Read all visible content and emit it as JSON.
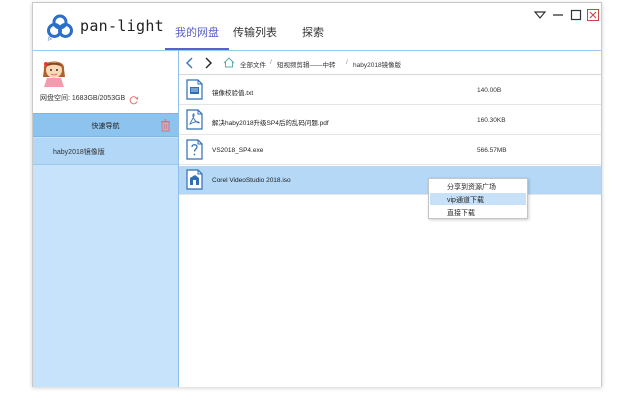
{
  "app": {
    "name": "pan-light",
    "accent_color": "#5b5fc7",
    "logo_icon": "cloud-logo"
  },
  "tabs": [
    {
      "label": "我的网盘",
      "active": true
    },
    {
      "label": "传输列表",
      "active": false
    },
    {
      "label": "探索",
      "active": false
    }
  ],
  "window_controls": {
    "dropdown": "chevron-down-icon",
    "minimize": "minimize-icon",
    "maximize": "maximize-icon",
    "close": "close-icon"
  },
  "sidebar": {
    "storage_label": "网盘空间: 1683GB/2053GB",
    "quick_nav_label": "快速导航",
    "items": [
      {
        "label": "haby2018镜像版"
      }
    ]
  },
  "pathbar": {
    "crumbs": [
      "全部文件",
      "短视频剪辑——中转",
      "haby2018镜像版"
    ]
  },
  "files": [
    {
      "name": "镜像校验值.txt",
      "size": "140.00B",
      "icon": "text-file-icon",
      "selected": false
    },
    {
      "name": "解决haby2018升级SP4后的乱码问题.pdf",
      "size": "160.30KB",
      "icon": "pdf-file-icon",
      "selected": false
    },
    {
      "name": "VS2018_SP4.exe",
      "size": "566.57MB",
      "icon": "unknown-file-icon",
      "selected": false
    },
    {
      "name": "Corel VideoStudio 2018.iso",
      "size": "",
      "icon": "disc-file-icon",
      "selected": true
    }
  ],
  "context_menu": {
    "items": [
      {
        "label": "分享到资源广场",
        "hover": false
      },
      {
        "label": "vip通道下载",
        "hover": true
      },
      {
        "label": "直接下载",
        "hover": false
      }
    ]
  }
}
